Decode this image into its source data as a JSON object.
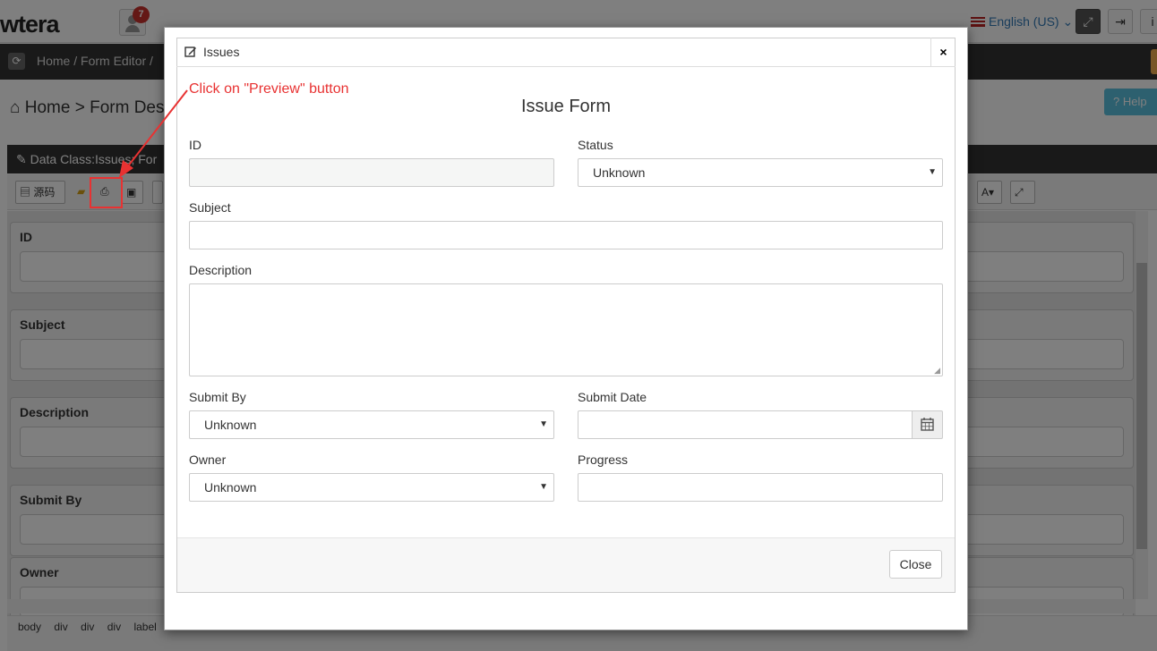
{
  "app": {
    "logo_text": "wtera",
    "notifications": "7",
    "language": "English (US)"
  },
  "nav": {
    "crumbs": "Home /  Form Editor /"
  },
  "page": {
    "heading": "Home > Form Desig",
    "help": "Help",
    "panel_title": "Data Class:Issues; For",
    "source_btn": "源码"
  },
  "editor_fields": [
    "ID",
    "Subject",
    "Description",
    "Submit By",
    "Owner"
  ],
  "status_path": [
    "body",
    "div",
    "div",
    "div",
    "label"
  ],
  "modal": {
    "title": "Issues",
    "close_symbol": "×",
    "form_title": "Issue Form",
    "fields": {
      "id_label": "ID",
      "status_label": "Status",
      "status_value": "Unknown",
      "subject_label": "Subject",
      "description_label": "Description",
      "submit_by_label": "Submit By",
      "submit_by_value": "Unknown",
      "submit_date_label": "Submit Date",
      "owner_label": "Owner",
      "owner_value": "Unknown",
      "progress_label": "Progress"
    },
    "close_button": "Close"
  },
  "annotation": {
    "callout_text": "Click on \"Preview\" button",
    "color": "#e83232"
  }
}
